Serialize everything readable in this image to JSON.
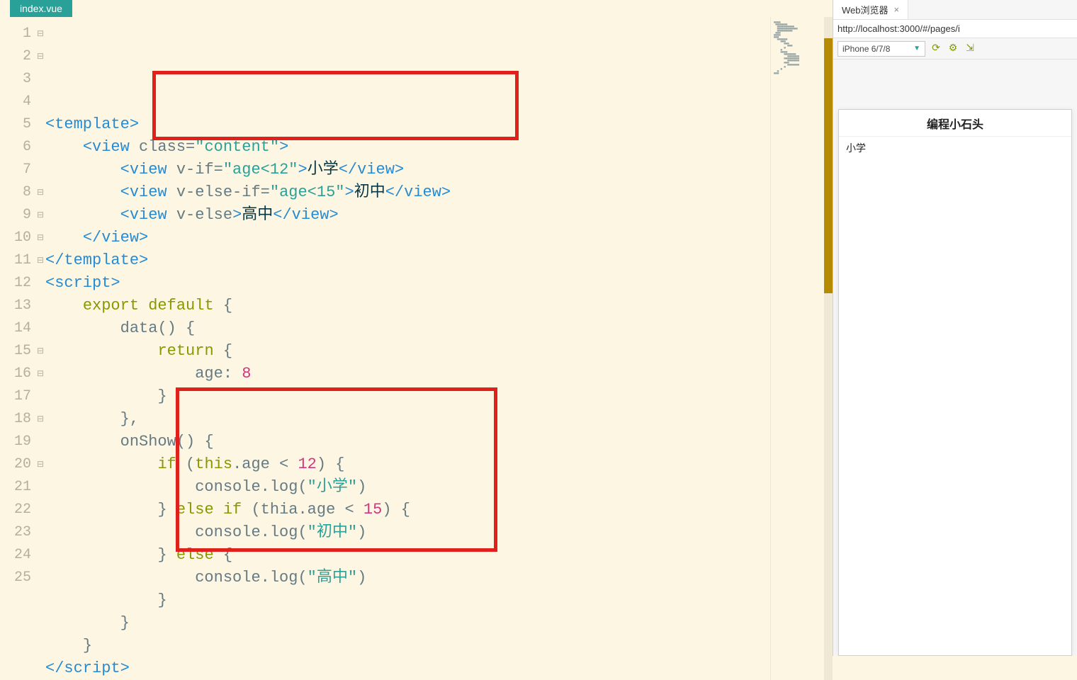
{
  "editor": {
    "tab_name": "index.vue",
    "line_count": 25,
    "foldable_lines": [
      1,
      2,
      8,
      9,
      10,
      11,
      15,
      16,
      18,
      20
    ],
    "highlight_boxes": [
      {
        "from_line": 3,
        "to_line": 5
      },
      {
        "from_line": 16,
        "to_line": 22
      }
    ],
    "code": [
      [
        {
          "t": "t-tag",
          "v": "<template>"
        }
      ],
      [
        {
          "t": "pad",
          "v": "    "
        },
        {
          "t": "t-tag",
          "v": "<view "
        },
        {
          "t": "t-attr",
          "v": "class"
        },
        {
          "t": "t-op",
          "v": "="
        },
        {
          "t": "t-str",
          "v": "\"content\""
        },
        {
          "t": "t-tag",
          "v": ">"
        }
      ],
      [
        {
          "t": "pad",
          "v": "        "
        },
        {
          "t": "t-tag",
          "v": "<view "
        },
        {
          "t": "t-attr",
          "v": "v-if"
        },
        {
          "t": "t-op",
          "v": "="
        },
        {
          "t": "t-str",
          "v": "\"age<12\""
        },
        {
          "t": "t-tag",
          "v": ">"
        },
        {
          "t": "t-dark",
          "v": "小学"
        },
        {
          "t": "t-tag",
          "v": "</view>"
        }
      ],
      [
        {
          "t": "pad",
          "v": "        "
        },
        {
          "t": "t-tag",
          "v": "<view "
        },
        {
          "t": "t-attr",
          "v": "v-else-if"
        },
        {
          "t": "t-op",
          "v": "="
        },
        {
          "t": "t-str",
          "v": "\"age<15\""
        },
        {
          "t": "t-tag",
          "v": ">"
        },
        {
          "t": "t-dark",
          "v": "初中"
        },
        {
          "t": "t-tag",
          "v": "</view>"
        }
      ],
      [
        {
          "t": "pad",
          "v": "        "
        },
        {
          "t": "t-tag",
          "v": "<view "
        },
        {
          "t": "t-attr",
          "v": "v-else"
        },
        {
          "t": "t-tag",
          "v": ">"
        },
        {
          "t": "t-dark",
          "v": "高中"
        },
        {
          "t": "t-tag",
          "v": "</view>"
        }
      ],
      [
        {
          "t": "pad",
          "v": "    "
        },
        {
          "t": "t-tag",
          "v": "</view>"
        }
      ],
      [
        {
          "t": "t-tag",
          "v": "</template>"
        }
      ],
      [
        {
          "t": "t-tag",
          "v": "<script>"
        }
      ],
      [
        {
          "t": "pad",
          "v": "    "
        },
        {
          "t": "t-kw",
          "v": "export default"
        },
        {
          "t": "t-plain",
          "v": " {"
        }
      ],
      [
        {
          "t": "pad",
          "v": "        "
        },
        {
          "t": "t-fn",
          "v": "data"
        },
        {
          "t": "t-plain",
          "v": "() {"
        }
      ],
      [
        {
          "t": "pad",
          "v": "            "
        },
        {
          "t": "t-kw",
          "v": "return"
        },
        {
          "t": "t-plain",
          "v": " {"
        }
      ],
      [
        {
          "t": "pad",
          "v": "                "
        },
        {
          "t": "t-plain",
          "v": "age: "
        },
        {
          "t": "t-num",
          "v": "8"
        }
      ],
      [
        {
          "t": "pad",
          "v": "            "
        },
        {
          "t": "t-plain",
          "v": "}"
        }
      ],
      [
        {
          "t": "pad",
          "v": "        "
        },
        {
          "t": "t-plain",
          "v": "},"
        }
      ],
      [
        {
          "t": "pad",
          "v": "        "
        },
        {
          "t": "t-fn",
          "v": "onShow"
        },
        {
          "t": "t-plain",
          "v": "() {"
        }
      ],
      [
        {
          "t": "pad",
          "v": "            "
        },
        {
          "t": "t-kw",
          "v": "if"
        },
        {
          "t": "t-plain",
          "v": " ("
        },
        {
          "t": "t-kw",
          "v": "this"
        },
        {
          "t": "t-plain",
          "v": ".age < "
        },
        {
          "t": "t-num",
          "v": "12"
        },
        {
          "t": "t-plain",
          "v": ") {"
        }
      ],
      [
        {
          "t": "pad",
          "v": "                "
        },
        {
          "t": "t-plain",
          "v": "console."
        },
        {
          "t": "t-fn",
          "v": "log"
        },
        {
          "t": "t-plain",
          "v": "("
        },
        {
          "t": "t-str",
          "v": "\"小学\""
        },
        {
          "t": "t-plain",
          "v": ")"
        }
      ],
      [
        {
          "t": "pad",
          "v": "            "
        },
        {
          "t": "t-plain",
          "v": "} "
        },
        {
          "t": "t-kw",
          "v": "else if"
        },
        {
          "t": "t-plain",
          "v": " (thia.age < "
        },
        {
          "t": "t-num",
          "v": "15"
        },
        {
          "t": "t-plain",
          "v": ") {"
        }
      ],
      [
        {
          "t": "pad",
          "v": "                "
        },
        {
          "t": "t-plain",
          "v": "console."
        },
        {
          "t": "t-fn",
          "v": "log"
        },
        {
          "t": "t-plain",
          "v": "("
        },
        {
          "t": "t-str",
          "v": "\"初中\""
        },
        {
          "t": "t-plain",
          "v": ")"
        }
      ],
      [
        {
          "t": "pad",
          "v": "            "
        },
        {
          "t": "t-plain",
          "v": "} "
        },
        {
          "t": "t-kw",
          "v": "else"
        },
        {
          "t": "t-plain",
          "v": " {"
        }
      ],
      [
        {
          "t": "pad",
          "v": "                "
        },
        {
          "t": "t-plain",
          "v": "console."
        },
        {
          "t": "t-fn",
          "v": "log"
        },
        {
          "t": "t-plain",
          "v": "("
        },
        {
          "t": "t-str",
          "v": "\"高中\""
        },
        {
          "t": "t-plain",
          "v": ")"
        }
      ],
      [
        {
          "t": "pad",
          "v": "            "
        },
        {
          "t": "t-plain",
          "v": "}"
        }
      ],
      [
        {
          "t": "pad",
          "v": "        "
        },
        {
          "t": "t-plain",
          "v": "}"
        }
      ],
      [
        {
          "t": "pad",
          "v": "    "
        },
        {
          "t": "t-plain",
          "v": "}"
        }
      ],
      [
        {
          "t": "t-tag",
          "v": "</scr"
        },
        {
          "t": "t-tag",
          "v": "ipt>"
        }
      ]
    ]
  },
  "browser": {
    "tab_label": "Web浏览器",
    "url": "http://localhost:3000/#/pages/i",
    "device": "iPhone 6/7/8",
    "icons": [
      "refresh-icon",
      "gear-icon",
      "popout-icon"
    ],
    "preview_title": "编程小石头",
    "preview_body": "小学"
  }
}
